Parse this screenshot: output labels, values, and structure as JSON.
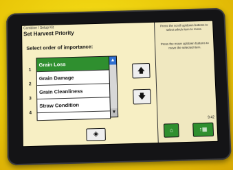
{
  "breadcrumb": "Combine / Setup Kit",
  "title": "Set Harvest Priority",
  "prompt": "Select order of importance:",
  "priority_numbers": [
    "1",
    "2",
    "3",
    "4"
  ],
  "priority_items": [
    "Grain Loss",
    "Grain Damage",
    "Grain Cleanliness",
    "Straw Condition"
  ],
  "selected_index": 0,
  "help": {
    "text1": "Press the scroll up/down buttons to select which item to move.",
    "text2": "Press the move up/down buttons to move the selected item."
  },
  "clock": "9:42",
  "icons": {
    "move_up": "arrow-up-icon",
    "move_down": "arrow-down-icon",
    "enter": "enter-icon",
    "home": "home-icon",
    "menu": "menu-icon",
    "scroll_up": "scroll-up-icon",
    "scroll_down": "scroll-down-icon"
  },
  "colors": {
    "selection": "#2f8f2f",
    "scroll_up": "#2f6fd0",
    "screen_bg": "#f7efc4"
  }
}
